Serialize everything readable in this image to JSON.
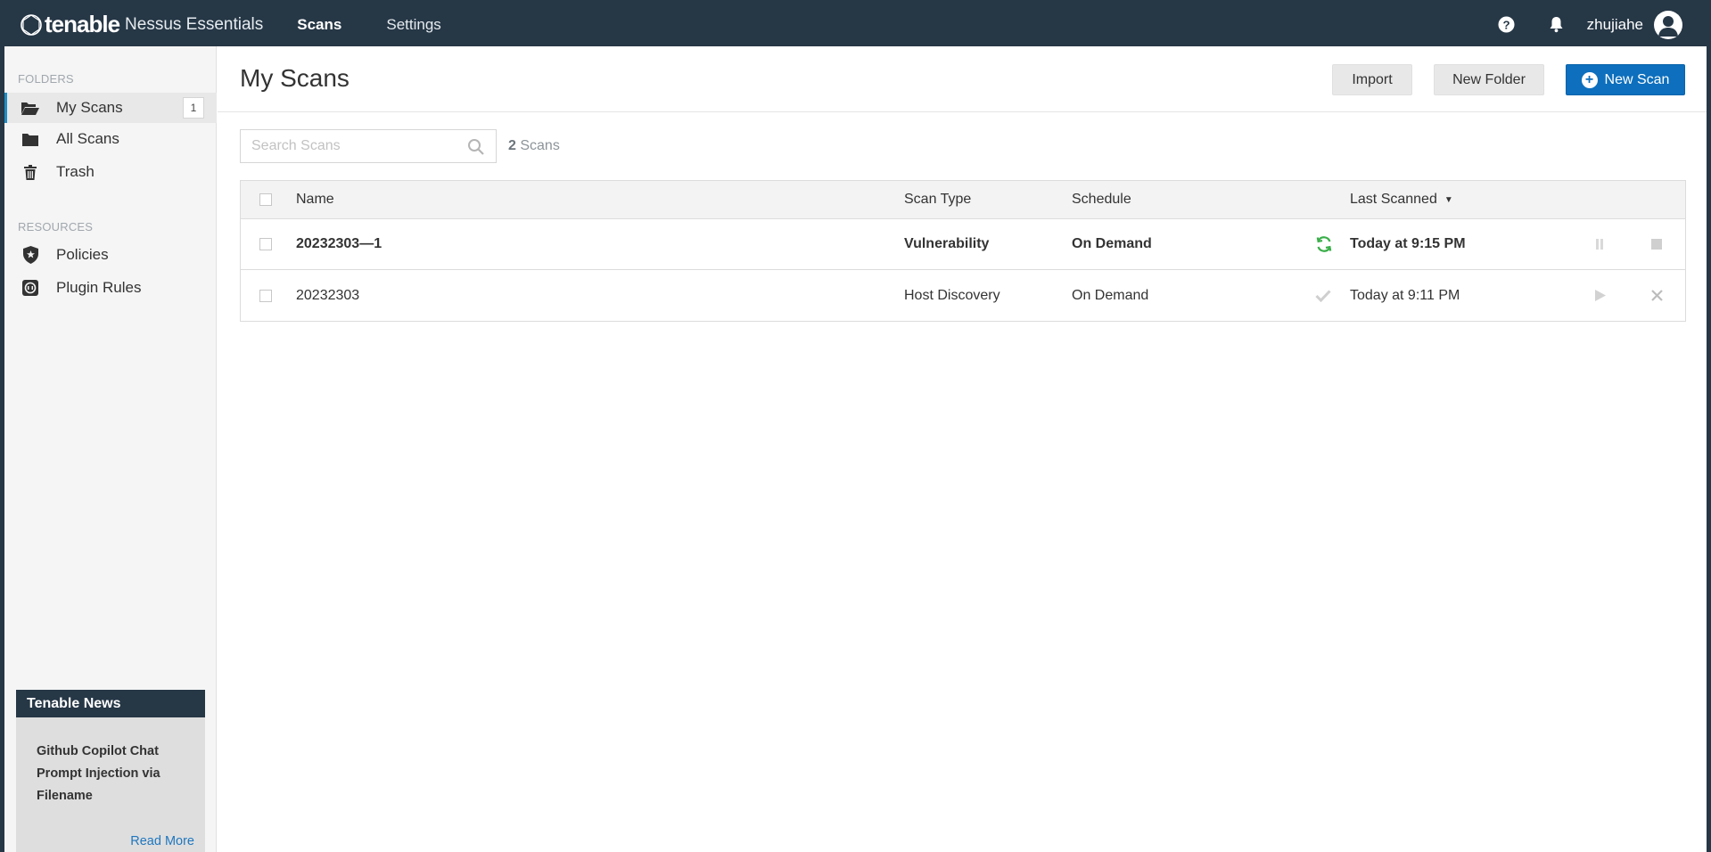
{
  "header": {
    "brand": "tenable",
    "product": "Nessus Essentials",
    "nav": [
      {
        "label": "Scans",
        "active": true
      },
      {
        "label": "Settings",
        "active": false
      }
    ],
    "username": "zhujiahe",
    "icons": [
      "help-icon",
      "bell-icon",
      "user-avatar-icon"
    ]
  },
  "sidebar": {
    "folders_title": "FOLDERS",
    "folders": [
      {
        "label": "My Scans",
        "icon": "folder-open-icon",
        "badge": "1",
        "active": true
      },
      {
        "label": "All Scans",
        "icon": "folder-icon"
      },
      {
        "label": "Trash",
        "icon": "trash-icon"
      }
    ],
    "resources_title": "RESOURCES",
    "resources": [
      {
        "label": "Policies",
        "icon": "shield-star-icon"
      },
      {
        "label": "Plugin Rules",
        "icon": "plugin-rules-icon"
      }
    ],
    "news": {
      "title": "Tenable News",
      "headline": "Github Copilot Chat Prompt Injection via Filename",
      "link": "Read More"
    }
  },
  "main": {
    "title": "My Scans",
    "buttons": {
      "import": "Import",
      "new_folder": "New Folder",
      "new_scan": "New Scan"
    },
    "search": {
      "placeholder": "Search Scans",
      "value": ""
    },
    "count_number": "2",
    "count_label": "Scans",
    "table": {
      "columns": {
        "name": "Name",
        "scan_type": "Scan Type",
        "schedule": "Schedule",
        "last_scanned": "Last Scanned"
      },
      "rows": [
        {
          "name": "20232303—1",
          "scan_type": "Vulnerability",
          "schedule": "On Demand",
          "status_icon": "running-refresh-icon",
          "last_scanned": "Today at 9:15 PM",
          "actions": [
            "pause-icon",
            "stop-icon"
          ],
          "bold": true
        },
        {
          "name": "20232303",
          "scan_type": "Host Discovery",
          "schedule": "On Demand",
          "status_icon": "completed-check-icon",
          "last_scanned": "Today at 9:11 PM",
          "actions": [
            "play-icon",
            "delete-x-icon"
          ],
          "bold": false
        }
      ]
    }
  },
  "colors": {
    "header_bg": "#263746",
    "primary_button": "#0d6fbd",
    "running_green": "#3aae49",
    "active_accent": "#1f8dc3"
  }
}
